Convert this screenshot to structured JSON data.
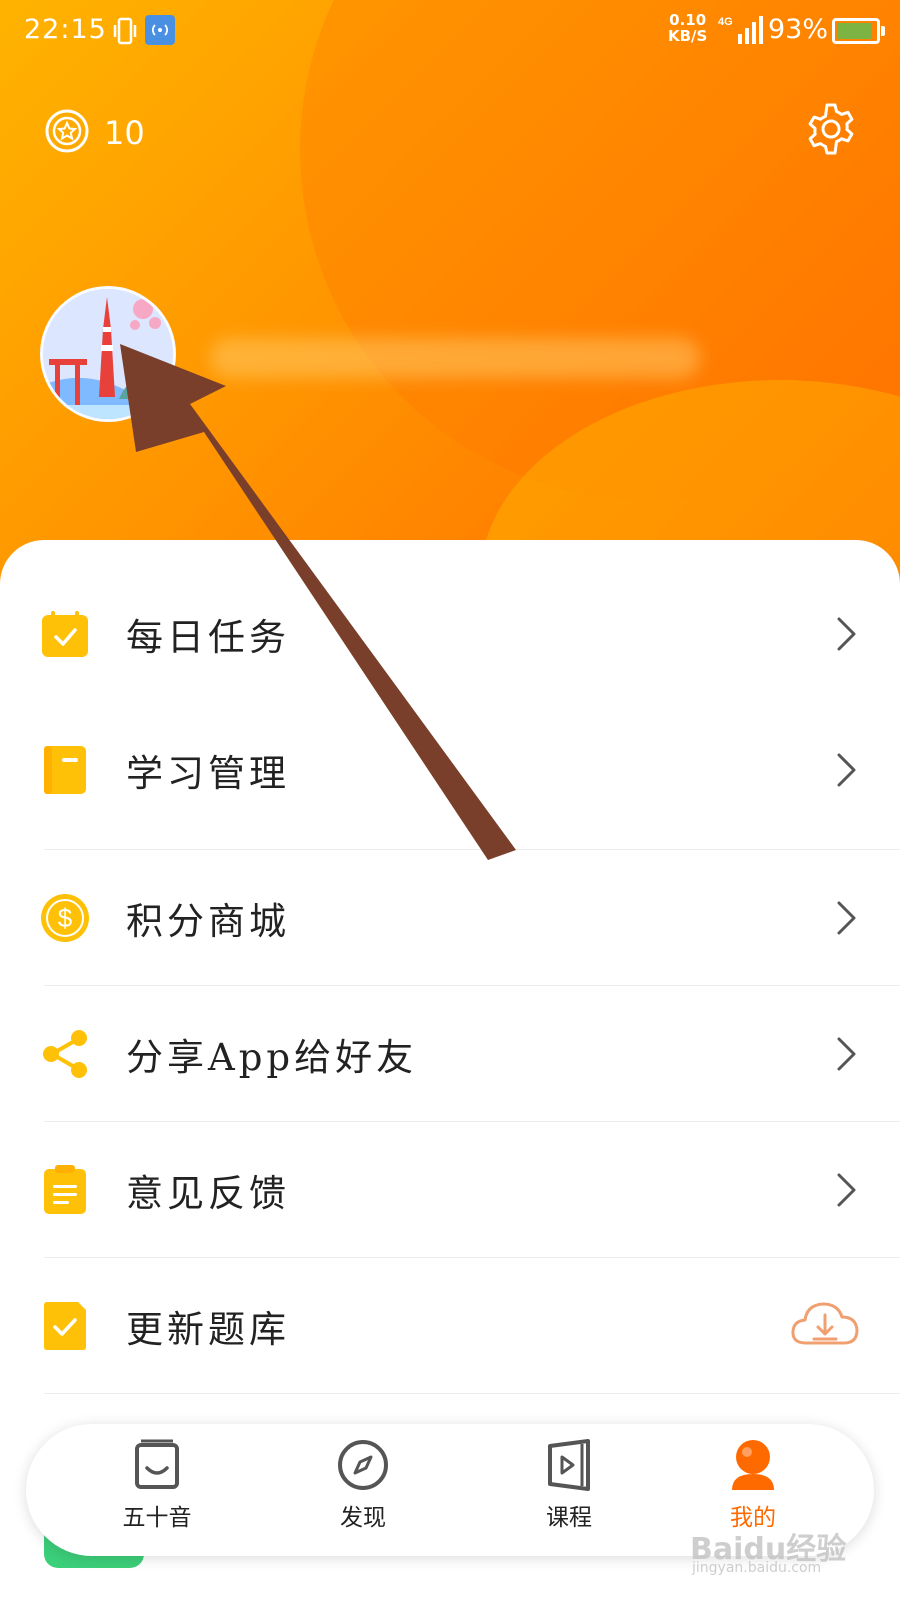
{
  "status_bar": {
    "time": "22:15",
    "speed_value": "0.10",
    "speed_unit": "KB/S",
    "network": "4G",
    "battery_percent": "93%",
    "battery_level": 0.93,
    "icons": [
      "vibrate-icon",
      "nfc-icon",
      "signal-icon",
      "battery-icon"
    ]
  },
  "header": {
    "coins": "10",
    "coin_icon": "star-coin-icon",
    "settings_icon": "gear-icon",
    "avatar_icon": "avatar-tokyo-tower-icon",
    "colors": {
      "gradient_start": "#ffb300",
      "gradient_end": "#ff6a00"
    }
  },
  "menu": {
    "items": [
      {
        "label": "每日任务",
        "icon": "calendar-check-icon",
        "trailing": "chevron-right-icon"
      },
      {
        "label": "学习管理",
        "icon": "notebook-icon",
        "trailing": "chevron-right-icon"
      },
      {
        "label": "积分商城",
        "icon": "dollar-coin-icon",
        "trailing": "chevron-right-icon"
      },
      {
        "label": "分享App给好友",
        "icon": "share-icon",
        "trailing": "chevron-right-icon"
      },
      {
        "label": "意见反馈",
        "icon": "clipboard-icon",
        "trailing": "chevron-right-icon"
      },
      {
        "label": "更新题库",
        "icon": "check-file-icon",
        "trailing": "cloud-download-icon"
      }
    ],
    "colors": {
      "icon": "#ffc107",
      "download": "#f0a070"
    }
  },
  "tabbar": {
    "tabs": [
      {
        "label": "五十音",
        "icon": "kana-book-icon",
        "active": false
      },
      {
        "label": "发现",
        "icon": "compass-icon",
        "active": false
      },
      {
        "label": "课程",
        "icon": "video-course-icon",
        "active": false
      },
      {
        "label": "我的",
        "icon": "profile-icon",
        "active": true
      }
    ],
    "colors": {
      "active": "#ff6a00",
      "inactive": "#555555"
    }
  },
  "watermark": {
    "brand": "Baidu经验",
    "url": "jingyan.baidu.com"
  },
  "annotation": {
    "icon": "pointer-arrow-icon",
    "color": "#7a3f2a"
  }
}
